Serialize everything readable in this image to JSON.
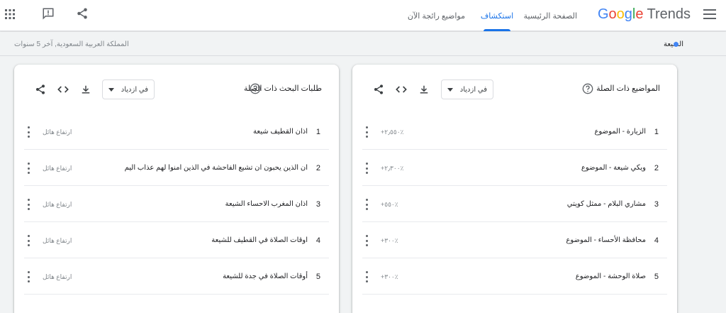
{
  "header": {
    "logo_google": [
      "G",
      "o",
      "o",
      "g",
      "l",
      "e"
    ],
    "logo_trends": "Trends",
    "nav": {
      "home": "الصفحة الرئيسية",
      "explore": "استكشاف",
      "trending": "مواضيع رائجة الآن"
    }
  },
  "filter": {
    "term": "الشيعة",
    "scope": "المملكة العربية السعودية, آخر 5 سنوات"
  },
  "topics_card": {
    "title": "المواضيع ذات الصلة",
    "dropdown": "في ازدياد",
    "rows": [
      {
        "rank": "1",
        "label": "الزيارة - الموضوع",
        "value": "+٢٫٥٥٠٪"
      },
      {
        "rank": "2",
        "label": "ويكي شيعة - الموضوع",
        "value": "+٢٫٣٠٠٪"
      },
      {
        "rank": "3",
        "label": "مشاري البلام - ممثل كويتي",
        "value": "+٥٥٠٪"
      },
      {
        "rank": "4",
        "label": "محافظة الأحساء - الموضوع",
        "value": "+٣٠٠٪"
      },
      {
        "rank": "5",
        "label": "صلاة الوحشة - الموضوع",
        "value": "+٣٠٠٪"
      }
    ]
  },
  "queries_card": {
    "title": "طلبات البحث ذات الصلة",
    "dropdown": "في ازدياد",
    "rows": [
      {
        "rank": "1",
        "label": "اذان القطيف شيعة",
        "value": "ارتفاع هائل"
      },
      {
        "rank": "2",
        "label": "ان الذين يحبون ان تشيع الفاحشة في الذين امنوا لهم عذاب اليم",
        "value": "ارتفاع هائل"
      },
      {
        "rank": "3",
        "label": "اذان المغرب الاحساء الشيعة",
        "value": "ارتفاع هائل"
      },
      {
        "rank": "4",
        "label": "اوقات الصلاة في القطيف للشيعة",
        "value": "ارتفاع هائل"
      },
      {
        "rank": "5",
        "label": "أوقات الصلاة في جدة للشيعة",
        "value": "ارتفاع هائل"
      }
    ]
  }
}
